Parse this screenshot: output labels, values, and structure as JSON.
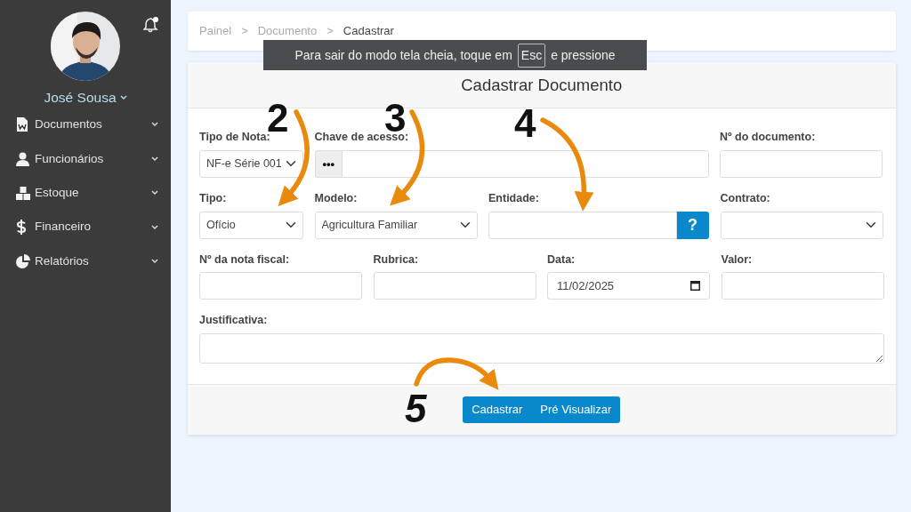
{
  "sidebar": {
    "user": {
      "name": "José Sousa"
    },
    "notifications": {
      "unread": true
    },
    "items": [
      {
        "label": "Documentos"
      },
      {
        "label": "Funcionários"
      },
      {
        "label": "Estoque"
      },
      {
        "label": "Financeiro"
      },
      {
        "label": "Relatórios"
      }
    ]
  },
  "breadcrumb": {
    "separator": ">",
    "items": [
      {
        "label": "Painel",
        "current": false
      },
      {
        "label": "Documento",
        "current": false
      },
      {
        "label": "Cadastrar",
        "current": true
      }
    ]
  },
  "fullscreen_notice": {
    "text_before": "Para sair do modo tela cheia, toque em",
    "key": "Esc",
    "text_after": "e pressione"
  },
  "form": {
    "title": "Cadastrar Documento",
    "field_groups": [
      {
        "fields": [
          {
            "kind": "select",
            "label": "Tipo de Nota:",
            "value": "NF-e Série 001"
          },
          {
            "kind": "addon-input",
            "label": "Chave de acesso:",
            "addon": "•••"
          },
          {
            "kind": "input",
            "label": "Nº do documento:"
          }
        ]
      },
      {
        "fields": [
          {
            "kind": "select",
            "label": "Tipo:",
            "value": "Ofício"
          },
          {
            "kind": "select",
            "label": "Modelo:",
            "value": "Agricultura Familiar"
          },
          {
            "kind": "help-input",
            "label": "Entidade:",
            "addon": "?"
          },
          {
            "kind": "select",
            "label": "Contrato:"
          }
        ]
      },
      {
        "fields": [
          {
            "kind": "input",
            "label": "Nº da nota fiscal:"
          },
          {
            "kind": "input",
            "label": "Rubrica:"
          },
          {
            "kind": "date",
            "label": "Data:",
            "value": "11/02/2025"
          },
          {
            "kind": "input",
            "label": "Valor:"
          }
        ]
      },
      {
        "fields": [
          {
            "kind": "textarea",
            "label": "Justificativa:"
          }
        ]
      }
    ],
    "buttons": [
      "Cadastrar",
      "Pré Visualizar"
    ]
  },
  "annotations": [
    {
      "label": "2"
    },
    {
      "label": "3"
    },
    {
      "label": "4"
    },
    {
      "label": "5"
    }
  ]
}
